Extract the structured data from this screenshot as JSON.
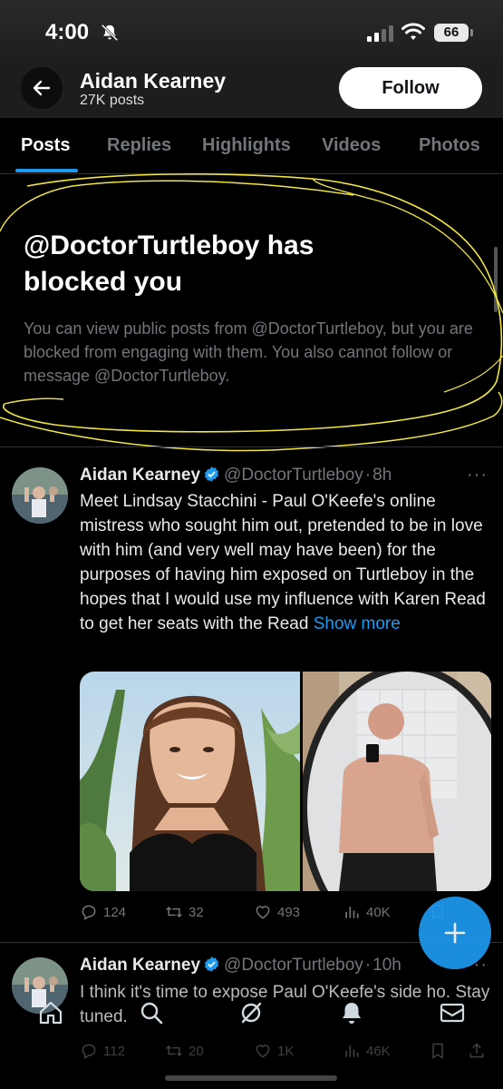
{
  "status_bar": {
    "time": "4:00",
    "battery": "66"
  },
  "header": {
    "name": "Aidan Kearney",
    "posts": "27K posts",
    "follow_label": "Follow"
  },
  "tabs": [
    {
      "label": "Posts",
      "active": true
    },
    {
      "label": "Replies",
      "active": false
    },
    {
      "label": "Highlights",
      "active": false
    },
    {
      "label": "Videos",
      "active": false
    },
    {
      "label": "Photos",
      "active": false
    }
  ],
  "blocked": {
    "title": "@DoctorTurtleboy has blocked you",
    "description": "You can view public posts from @DoctorTurtleboy, but you are blocked from engaging with them. You also cannot follow or message @DoctorTurtleboy."
  },
  "tweets": [
    {
      "author": "Aidan Kearney",
      "handle": "@DoctorTurtleboy",
      "time": "8h",
      "text": "Meet Lindsay Stacchini - Paul O'Keefe's online mistress who sought him out, pretended to be in love with him (and very well may have been) for the purposes of having him exposed on Turtleboy in the hopes that I would use my influence with Karen Read to get her seats with the Read",
      "show_more": "Show more",
      "replies": "124",
      "reposts": "32",
      "likes": "493",
      "views": "40K"
    },
    {
      "author": "Aidan Kearney",
      "handle": "@DoctorTurtleboy",
      "time": "10h",
      "text": "I think it's time to expose Paul O'Keefe's side ho. Stay tuned.",
      "replies": "112",
      "reposts": "20",
      "likes": "1K",
      "views": "46K"
    }
  ],
  "colors": {
    "accent": "#1d9bf0",
    "background": "#000000",
    "muted_text": "#71767b",
    "annotation": "#f2e640"
  },
  "icons": [
    "back-arrow-icon",
    "bell-off-icon",
    "signal-icon",
    "wifi-icon",
    "verified-badge-icon",
    "reply-icon",
    "repost-icon",
    "like-icon",
    "views-icon",
    "bookmark-icon",
    "share-icon",
    "compose-icon",
    "home-icon",
    "search-icon",
    "grok-icon",
    "notifications-icon",
    "messages-icon"
  ]
}
